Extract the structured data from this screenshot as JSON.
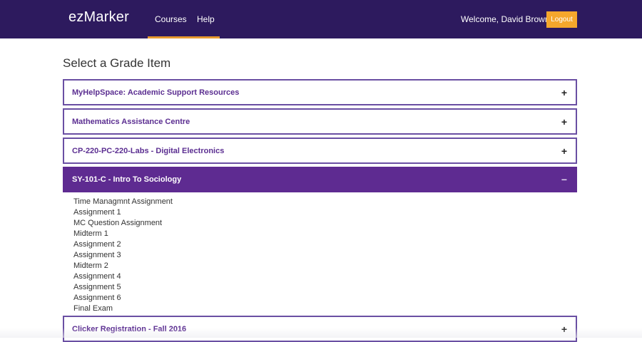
{
  "header": {
    "brand": "ezMarker",
    "nav": [
      "Courses",
      "Help"
    ],
    "welcome": "Welcome, David Brown",
    "logout_label": "Logout",
    "colors": {
      "bar": "#2d1a5e",
      "accent": "#e79a2f",
      "logout": "#f5a72c"
    }
  },
  "main": {
    "title": "Select a Grade Item",
    "panels": [
      {
        "label": "MyHelpSpace: Academic Support Resources",
        "toggle": "+"
      },
      {
        "label": "Mathematics Assistance Centre",
        "toggle": "+"
      },
      {
        "label": "CP-220-PC-220-Labs - Digital Electronics",
        "toggle": "+"
      },
      {
        "label": "SY-101-C - Intro To Sociology",
        "toggle": "−"
      },
      {
        "label": "Clicker Registration - Fall 2016",
        "toggle": "+"
      }
    ],
    "open_panel_items": [
      "Time Managmnt Assignment",
      "Assignment 1",
      "MC Question Assignment",
      "Midterm 1",
      "Assignment 2",
      "Assignment 3",
      "Midterm 2",
      "Assignment 4",
      "Assignment 5",
      "Assignment 6",
      "Final Exam"
    ],
    "colors": {
      "panel_border": "#6a4fa3",
      "panel_label": "#5b2e91",
      "open_panel_bg": "#5e2b91"
    }
  }
}
